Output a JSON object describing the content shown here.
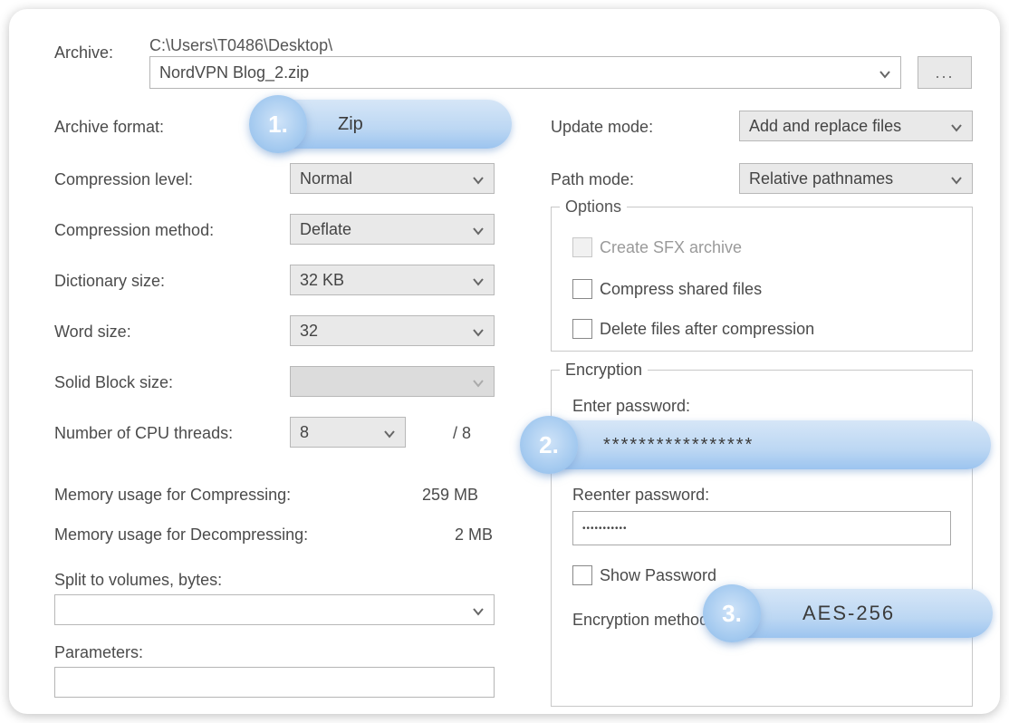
{
  "archive": {
    "label": "Archive:",
    "path": "C:\\Users\\T0486\\Desktop\\",
    "filename": "NordVPN Blog_2.zip",
    "browse": "..."
  },
  "format": {
    "label": "Archive format:",
    "value": "Zip"
  },
  "level": {
    "label": "Compression level:",
    "value": "Normal"
  },
  "method": {
    "label": "Compression method:",
    "value": "Deflate"
  },
  "dict": {
    "label": "Dictionary size:",
    "value": "32 KB"
  },
  "word": {
    "label": "Word size:",
    "value": "32"
  },
  "solid": {
    "label": "Solid Block size:",
    "value": ""
  },
  "cpu": {
    "label": "Number of CPU threads:",
    "value": "8",
    "total": "/ 8"
  },
  "mem_c": {
    "label": "Memory usage for Compressing:",
    "value": "259 MB"
  },
  "mem_d": {
    "label": "Memory usage for Decompressing:",
    "value": "2 MB"
  },
  "split": {
    "label": "Split to volumes, bytes:",
    "value": ""
  },
  "params": {
    "label": "Parameters:",
    "value": ""
  },
  "update": {
    "label": "Update mode:",
    "value": "Add and replace files"
  },
  "pathmode": {
    "label": "Path mode:",
    "value": "Relative pathnames"
  },
  "options": {
    "title": "Options",
    "sfx": "Create SFX archive",
    "shared": "Compress shared files",
    "delete": "Delete files after compression"
  },
  "encryption": {
    "title": "Encryption",
    "enter_label": "Enter password:",
    "password_mask": "*****************",
    "reenter_label": "Reenter password:",
    "reenter_mask": "•••••••••••",
    "show_label": "Show Password",
    "method_label": "Encryption method:",
    "method_value": "AES-256"
  },
  "callouts": {
    "one": "1.",
    "two": "2.",
    "three": "3."
  }
}
